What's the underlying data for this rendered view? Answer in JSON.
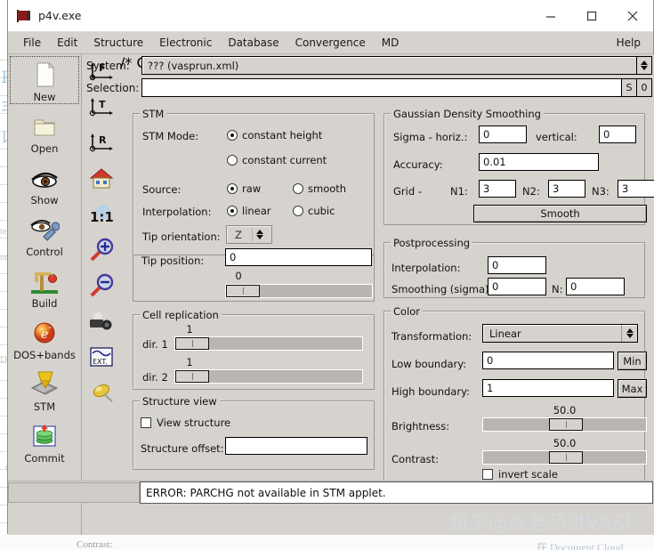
{
  "window": {
    "title": "p4v.exe",
    "app_icon": "p4-flag-icon",
    "minimize": "minimize-icon",
    "maximize": "maximize-icon",
    "close": "close-icon"
  },
  "menubar": {
    "items": [
      "File",
      "Edit",
      "Structure",
      "Electronic",
      "Database",
      "Convergence",
      "MD"
    ],
    "help": "Help"
  },
  "sidebar": {
    "items": [
      {
        "label": "New",
        "icon": "new-document-icon",
        "selected": true
      },
      {
        "label": "Open",
        "icon": "open-folder-icon",
        "selected": false
      },
      {
        "label": "Show",
        "icon": "eye-icon",
        "selected": false
      },
      {
        "label": "Control",
        "icon": "eye-wrench-icon",
        "selected": false
      },
      {
        "label": "Build",
        "icon": "build-atom-icon",
        "selected": false
      },
      {
        "label": "DOS+bands",
        "icon": "electron-icon",
        "selected": false
      },
      {
        "label": "STM",
        "icon": "stm-tip-icon",
        "selected": false
      },
      {
        "label": "Commit",
        "icon": "commit-stack-icon",
        "selected": false
      }
    ]
  },
  "toolstrip": {
    "items": [
      {
        "name": "axis-front-icon",
        "label": "F"
      },
      {
        "name": "axis-top-icon",
        "label": "T"
      },
      {
        "name": "axis-right-icon",
        "label": "R"
      },
      {
        "name": "home-icon",
        "label": ""
      },
      {
        "name": "one-to-one-icon",
        "label": "1:1"
      },
      {
        "name": "zoom-in-icon",
        "label": ""
      },
      {
        "name": "zoom-out-icon",
        "label": ""
      },
      {
        "name": "camera-icon",
        "label": ""
      },
      {
        "name": "external-plot-icon",
        "label": "EXT."
      },
      {
        "name": "pin-icon",
        "label": ""
      }
    ]
  },
  "top_fields": {
    "system_label": "System:",
    "system_value": "??? (vasprun.xml)",
    "selection_label": "Selection:",
    "selection_value": "",
    "selection_placeholder": "",
    "btn_s": "S",
    "btn_0": "0"
  },
  "stm_panel": {
    "title": "STM",
    "mode_label": "STM Mode:",
    "mode_options": [
      {
        "label": "constant height",
        "selected": true
      },
      {
        "label": "constant current",
        "selected": false
      }
    ],
    "source_label": "Source:",
    "source_options": [
      {
        "label": "raw",
        "selected": true
      },
      {
        "label": "smooth",
        "selected": false
      }
    ],
    "interpolation_label": "Interpolation:",
    "interpolation_options": [
      {
        "label": "linear",
        "selected": true
      },
      {
        "label": "cubic",
        "selected": false
      }
    ],
    "tip_orientation_label": "Tip orientation:",
    "tip_orientation_value": "Z",
    "tip_position_label": "Tip position:",
    "tip_position_value": "0",
    "tip_slider_value": "0"
  },
  "cell_panel": {
    "title": "Cell replication",
    "dir1_label": "dir. 1",
    "dir1_value": "1",
    "dir2_label": "dir. 2",
    "dir2_value": "1"
  },
  "structure_panel": {
    "title": "Structure view",
    "view_structure_label": "View structure",
    "view_structure_checked": false,
    "offset_label": "Structure offset:",
    "offset_value": ""
  },
  "gaussian_panel": {
    "title": "Gaussian Density Smoothing",
    "sigma_label": "Sigma - horiz.:",
    "sigma_horiz_value": "0",
    "vertical_label": "vertical:",
    "sigma_vert_value": "0",
    "accuracy_label": "Accuracy:",
    "accuracy_value": "0.01",
    "grid_label": "Grid -",
    "n1_label": "N1:",
    "n1_value": "3",
    "n2_label": "N2:",
    "n2_value": "3",
    "n3_label": "N3:",
    "n3_value": "3",
    "smooth_button": "Smooth"
  },
  "postprocessing_panel": {
    "title": "Postprocessing",
    "interpolation_label": "Interpolation:",
    "interpolation_value": "0",
    "smoothing_label": "Smoothing (sigma):",
    "smoothing_value": "0",
    "n_label": "N:",
    "n_value": "0"
  },
  "color_panel": {
    "title": "Color",
    "transformation_label": "Transformation:",
    "transformation_value": "Linear",
    "low_boundary_label": "Low boundary:",
    "low_boundary_value": "0",
    "min_button": "Min",
    "high_boundary_label": "High boundary:",
    "high_boundary_value": "1",
    "max_button": "Max",
    "brightness_label": "Brightness:",
    "brightness_value": "50.0",
    "contrast_label": "Contrast:",
    "contrast_value": "50.0",
    "invert_scale_label": "invert scale",
    "invert_scale_checked": false
  },
  "statusbar": {
    "message": "ERROR: PARCHG not available in STM applet."
  },
  "watermark": {
    "text": "知乎@朱老师讲VASP"
  },
  "background_doc": {
    "faint_text_1": "ter",
    "faint_text_2": "ur",
    "faint_text_3": "DOS+bands",
    "faint_text_4": "Commit",
    "faint_text_5": "Contrast:",
    "faint_text_6": "在 Document Cloud"
  },
  "colors": {
    "window_face": "#d6d3ce",
    "field_bg": "#ffffff",
    "border": "#000000",
    "title_bg": "#ffffff",
    "slider_track": "#b9b6b1"
  }
}
